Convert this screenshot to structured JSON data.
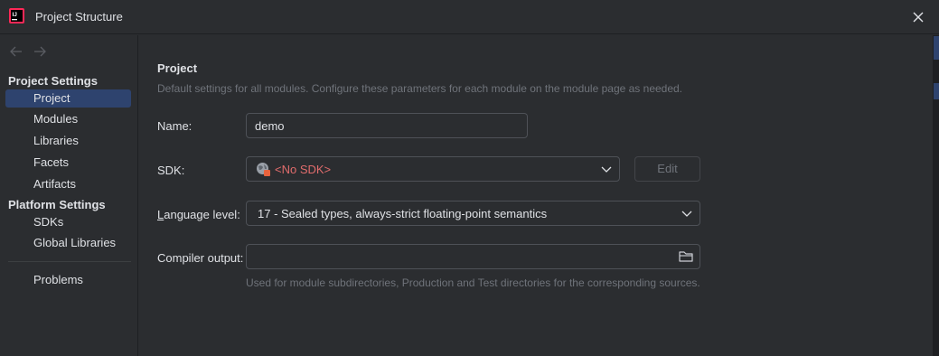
{
  "window": {
    "title": "Project Structure",
    "app_icon": "intellij-icon",
    "close_icon": "close-icon"
  },
  "sidebar": {
    "back_icon": "arrow-left-icon",
    "forward_icon": "arrow-right-icon",
    "group_project_settings": "Project Settings",
    "group_platform_settings": "Platform Settings",
    "items": [
      {
        "label": "Project"
      },
      {
        "label": "Modules"
      },
      {
        "label": "Libraries"
      },
      {
        "label": "Facets"
      },
      {
        "label": "Artifacts"
      },
      {
        "label": "SDKs"
      },
      {
        "label": "Global Libraries"
      },
      {
        "label": "Problems"
      }
    ],
    "selected": "Project"
  },
  "main": {
    "title": "Project",
    "description": "Default settings for all modules. Configure these parameters for each module on the module page as needed.",
    "name_label": "Name:",
    "name_value": "demo",
    "sdk_label": "SDK:",
    "sdk_value": "<No SDK>",
    "sdk_edit_label": "Edit",
    "language_level_label": "Language level:",
    "language_level_value": "17 - Sealed types, always-strict floating-point semantics",
    "compiler_output_label": "Compiler output:",
    "compiler_output_value": "",
    "compiler_output_hint": "Used for module subdirectories, Production and Test directories for the corresponding sources."
  },
  "colors": {
    "background": "#2b2d30",
    "selection": "#2e436e",
    "error_text": "#e06c6c",
    "muted_text": "#6f737a"
  }
}
